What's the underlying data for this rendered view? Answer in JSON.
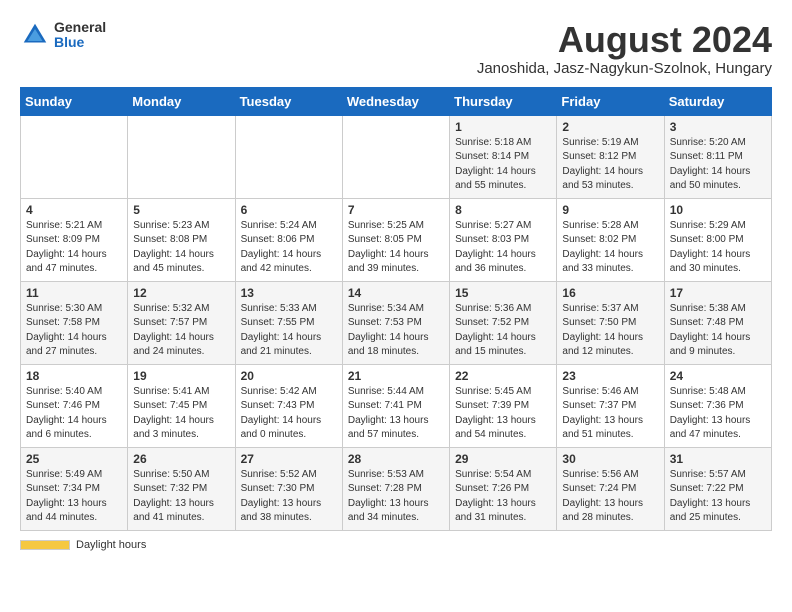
{
  "logo": {
    "general": "General",
    "blue": "Blue"
  },
  "title": "August 2024",
  "subtitle": "Janoshida, Jasz-Nagykun-Szolnok, Hungary",
  "days_of_week": [
    "Sunday",
    "Monday",
    "Tuesday",
    "Wednesday",
    "Thursday",
    "Friday",
    "Saturday"
  ],
  "weeks": [
    [
      {
        "day": "",
        "info": ""
      },
      {
        "day": "",
        "info": ""
      },
      {
        "day": "",
        "info": ""
      },
      {
        "day": "",
        "info": ""
      },
      {
        "day": "1",
        "info": "Sunrise: 5:18 AM\nSunset: 8:14 PM\nDaylight: 14 hours\nand 55 minutes."
      },
      {
        "day": "2",
        "info": "Sunrise: 5:19 AM\nSunset: 8:12 PM\nDaylight: 14 hours\nand 53 minutes."
      },
      {
        "day": "3",
        "info": "Sunrise: 5:20 AM\nSunset: 8:11 PM\nDaylight: 14 hours\nand 50 minutes."
      }
    ],
    [
      {
        "day": "4",
        "info": "Sunrise: 5:21 AM\nSunset: 8:09 PM\nDaylight: 14 hours\nand 47 minutes."
      },
      {
        "day": "5",
        "info": "Sunrise: 5:23 AM\nSunset: 8:08 PM\nDaylight: 14 hours\nand 45 minutes."
      },
      {
        "day": "6",
        "info": "Sunrise: 5:24 AM\nSunset: 8:06 PM\nDaylight: 14 hours\nand 42 minutes."
      },
      {
        "day": "7",
        "info": "Sunrise: 5:25 AM\nSunset: 8:05 PM\nDaylight: 14 hours\nand 39 minutes."
      },
      {
        "day": "8",
        "info": "Sunrise: 5:27 AM\nSunset: 8:03 PM\nDaylight: 14 hours\nand 36 minutes."
      },
      {
        "day": "9",
        "info": "Sunrise: 5:28 AM\nSunset: 8:02 PM\nDaylight: 14 hours\nand 33 minutes."
      },
      {
        "day": "10",
        "info": "Sunrise: 5:29 AM\nSunset: 8:00 PM\nDaylight: 14 hours\nand 30 minutes."
      }
    ],
    [
      {
        "day": "11",
        "info": "Sunrise: 5:30 AM\nSunset: 7:58 PM\nDaylight: 14 hours\nand 27 minutes."
      },
      {
        "day": "12",
        "info": "Sunrise: 5:32 AM\nSunset: 7:57 PM\nDaylight: 14 hours\nand 24 minutes."
      },
      {
        "day": "13",
        "info": "Sunrise: 5:33 AM\nSunset: 7:55 PM\nDaylight: 14 hours\nand 21 minutes."
      },
      {
        "day": "14",
        "info": "Sunrise: 5:34 AM\nSunset: 7:53 PM\nDaylight: 14 hours\nand 18 minutes."
      },
      {
        "day": "15",
        "info": "Sunrise: 5:36 AM\nSunset: 7:52 PM\nDaylight: 14 hours\nand 15 minutes."
      },
      {
        "day": "16",
        "info": "Sunrise: 5:37 AM\nSunset: 7:50 PM\nDaylight: 14 hours\nand 12 minutes."
      },
      {
        "day": "17",
        "info": "Sunrise: 5:38 AM\nSunset: 7:48 PM\nDaylight: 14 hours\nand 9 minutes."
      }
    ],
    [
      {
        "day": "18",
        "info": "Sunrise: 5:40 AM\nSunset: 7:46 PM\nDaylight: 14 hours\nand 6 minutes."
      },
      {
        "day": "19",
        "info": "Sunrise: 5:41 AM\nSunset: 7:45 PM\nDaylight: 14 hours\nand 3 minutes."
      },
      {
        "day": "20",
        "info": "Sunrise: 5:42 AM\nSunset: 7:43 PM\nDaylight: 14 hours\nand 0 minutes."
      },
      {
        "day": "21",
        "info": "Sunrise: 5:44 AM\nSunset: 7:41 PM\nDaylight: 13 hours\nand 57 minutes."
      },
      {
        "day": "22",
        "info": "Sunrise: 5:45 AM\nSunset: 7:39 PM\nDaylight: 13 hours\nand 54 minutes."
      },
      {
        "day": "23",
        "info": "Sunrise: 5:46 AM\nSunset: 7:37 PM\nDaylight: 13 hours\nand 51 minutes."
      },
      {
        "day": "24",
        "info": "Sunrise: 5:48 AM\nSunset: 7:36 PM\nDaylight: 13 hours\nand 47 minutes."
      }
    ],
    [
      {
        "day": "25",
        "info": "Sunrise: 5:49 AM\nSunset: 7:34 PM\nDaylight: 13 hours\nand 44 minutes."
      },
      {
        "day": "26",
        "info": "Sunrise: 5:50 AM\nSunset: 7:32 PM\nDaylight: 13 hours\nand 41 minutes."
      },
      {
        "day": "27",
        "info": "Sunrise: 5:52 AM\nSunset: 7:30 PM\nDaylight: 13 hours\nand 38 minutes."
      },
      {
        "day": "28",
        "info": "Sunrise: 5:53 AM\nSunset: 7:28 PM\nDaylight: 13 hours\nand 34 minutes."
      },
      {
        "day": "29",
        "info": "Sunrise: 5:54 AM\nSunset: 7:26 PM\nDaylight: 13 hours\nand 31 minutes."
      },
      {
        "day": "30",
        "info": "Sunrise: 5:56 AM\nSunset: 7:24 PM\nDaylight: 13 hours\nand 28 minutes."
      },
      {
        "day": "31",
        "info": "Sunrise: 5:57 AM\nSunset: 7:22 PM\nDaylight: 13 hours\nand 25 minutes."
      }
    ]
  ],
  "footer": {
    "daylight_label": "Daylight hours"
  }
}
